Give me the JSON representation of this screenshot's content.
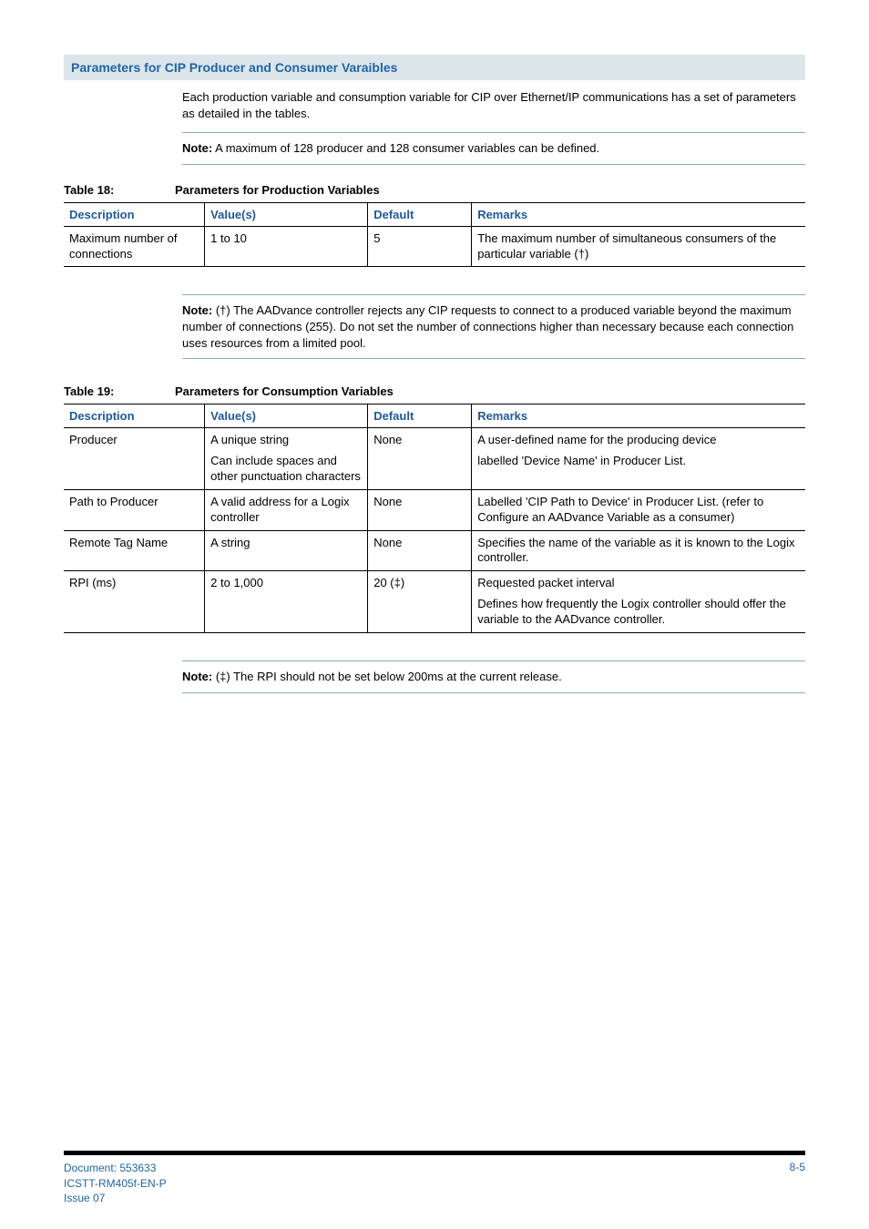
{
  "section_title": "Parameters for CIP Producer and Consumer Varaibles",
  "intro_para": "Each production variable and consumption variable for CIP over Ethernet/IP communications has a set of parameters as detailed in the tables.",
  "note1": "Note: A maximum of 128 producer and 128 consumer variables can be defined.",
  "table18": {
    "label": "Table 18:",
    "title": "Parameters for Production Variables",
    "headers": {
      "desc": "Description",
      "values": "Value(s)",
      "default": "Default",
      "remarks": "Remarks"
    },
    "rows": [
      {
        "desc": "Maximum number of connections",
        "values": "1 to 10",
        "default": "5",
        "remarks": "The maximum number of simultaneous consumers of the particular variable (†)"
      }
    ]
  },
  "note2": "Note: (†) The AADvance controller rejects any CIP requests to connect to a produced variable beyond the maximum number of connections (255). Do not set the number of connections higher than necessary because each connection uses resources from a limited pool.",
  "table19": {
    "label": "Table 19:",
    "title": "Parameters for Consumption Variables",
    "headers": {
      "desc": "Description",
      "values": "Value(s)",
      "default": "Default",
      "remarks": "Remarks"
    },
    "rows": [
      {
        "desc": "Producer",
        "values_line1": "A unique string",
        "values_line2": "Can include spaces and other punctuation characters",
        "default": "None",
        "remarks_line1": "A user-defined name for the producing device",
        "remarks_line2": "labelled 'Device Name' in Producer List."
      },
      {
        "desc": "Path to Producer",
        "values": "A valid address for a Logix controller",
        "default": "None",
        "remarks": "Labelled 'CIP Path to Device' in Producer List. (refer to Configure an AADvance Variable as a consumer)"
      },
      {
        "desc": "Remote Tag Name",
        "values": "A string",
        "default": "None",
        "remarks": "Specifies the name of the variable as it is known to the Logix controller."
      },
      {
        "desc": "RPI (ms)",
        "values": "2 to 1,000",
        "default": "20 (‡)",
        "remarks_line1": "Requested packet interval",
        "remarks_line2": "Defines how frequently the Logix controller should offer the variable to the AADvance controller."
      }
    ]
  },
  "note3": "Note: (‡) The RPI should not be set below 200ms at the current release.",
  "footer": {
    "doc": "Document: 553633",
    "ref": "ICSTT-RM405f-EN-P",
    "issue": "Issue 07",
    "page": "8-5"
  }
}
